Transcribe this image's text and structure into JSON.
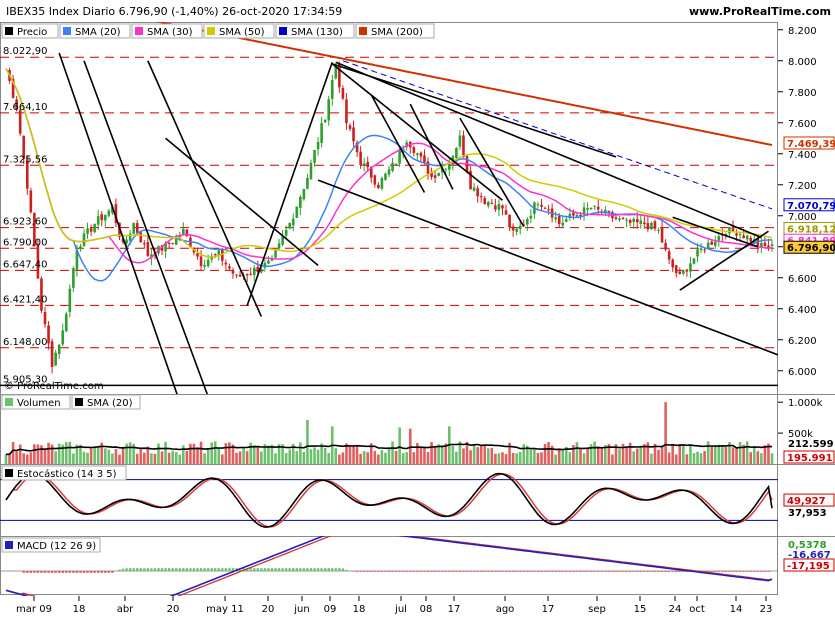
{
  "header": {
    "title": "IBEX35 Index Diario 6.796,90 (-1,40%) 26-oct-2020 17:34:59",
    "site": "www.ProRealTime.com",
    "copyright": "© ProRealTime.com"
  },
  "colors": {
    "price_line": "#000000",
    "sma20": "#3b82f6",
    "sma30": "#ff33cc",
    "sma50": "#cccc00",
    "sma130": "#0000cc",
    "sma200": "#cc3300",
    "up_candle": "#2e9e2e",
    "down_candle": "#cc1f1f",
    "level_line": "#cc0000",
    "vol_up": "#6cc06c",
    "vol_down": "#e06060"
  },
  "chart_data": [
    {
      "type": "candlestick",
      "title": "IBEX35 Index Diario",
      "legend": [
        "Precio",
        "SMA (20)",
        "SMA (30)",
        "SMA (50)",
        "SMA (130)",
        "SMA (200)"
      ],
      "x_ticks": [
        "mar 09",
        "18",
        "abr",
        "20",
        "may 11",
        "20",
        "jun",
        "09",
        "18",
        "jul",
        "08",
        "17",
        "ago",
        "17",
        "sep",
        "15",
        "24",
        "oct",
        "14",
        "23"
      ],
      "y_ticks": [
        "8.200",
        "8.000",
        "7.800",
        "7.600",
        "7.400",
        "7.200",
        "7.000",
        "6.800",
        "6.600",
        "6.400",
        "6.200",
        "6.000"
      ],
      "ylim": [
        5850,
        8250
      ],
      "levels": [
        8022.9,
        7664.1,
        7325.56,
        6923.6,
        6790.0,
        6647.4,
        6421.4,
        6148.0,
        5905.3
      ],
      "level_labels": [
        "8.022,90",
        "7.664,10",
        "7.325,56",
        "6.923,60",
        "6.790,00",
        "6.647,40",
        "6.421,40",
        "6.148,00",
        "5.905,30"
      ],
      "close_points": [
        [
          0,
          7950
        ],
        [
          3,
          7700
        ],
        [
          6,
          7200
        ],
        [
          10,
          6400
        ],
        [
          13,
          6050
        ],
        [
          16,
          6250
        ],
        [
          20,
          6800
        ],
        [
          25,
          6950
        ],
        [
          30,
          7050
        ],
        [
          33,
          6800
        ],
        [
          36,
          6950
        ],
        [
          40,
          6750
        ],
        [
          45,
          6800
        ],
        [
          50,
          6900
        ],
        [
          55,
          6700
        ],
        [
          60,
          6750
        ],
        [
          65,
          6600
        ],
        [
          70,
          6650
        ],
        [
          75,
          6700
        ],
        [
          80,
          6950
        ],
        [
          85,
          7250
        ],
        [
          90,
          7650
        ],
        [
          93,
          7980
        ],
        [
          96,
          7600
        ],
        [
          100,
          7350
        ],
        [
          105,
          7200
        ],
        [
          110,
          7350
        ],
        [
          113,
          7500
        ],
        [
          116,
          7400
        ],
        [
          120,
          7250
        ],
        [
          125,
          7350
        ],
        [
          128,
          7500
        ],
        [
          131,
          7200
        ],
        [
          135,
          7100
        ],
        [
          140,
          7050
        ],
        [
          143,
          6880
        ],
        [
          146,
          6950
        ],
        [
          150,
          7100
        ],
        [
          153,
          7050
        ],
        [
          156,
          6950
        ],
        [
          160,
          7000
        ],
        [
          165,
          7050
        ],
        [
          170,
          7000
        ],
        [
          175,
          6950
        ],
        [
          180,
          6950
        ],
        [
          184,
          6900
        ],
        [
          187,
          6700
        ],
        [
          190,
          6600
        ],
        [
          193,
          6700
        ],
        [
          196,
          6780
        ],
        [
          200,
          6850
        ],
        [
          203,
          6900
        ],
        [
          206,
          6900
        ],
        [
          210,
          6850
        ],
        [
          213,
          6800
        ],
        [
          216,
          6797
        ]
      ],
      "values": {
        "sma200": 7469.39,
        "sma130": 7070.79,
        "sma50": 6918.12,
        "sma30": 6841.99,
        "sma20": 6830,
        "close": 6796.9
      },
      "value_labels": [
        "7.469,39",
        "7.070,79",
        "6.918,12",
        "6.841,99",
        "6.796,90"
      ]
    },
    {
      "type": "bar",
      "title": "Volumen",
      "legend": [
        "Volumen",
        "SMA (20)"
      ],
      "y_ticks": [
        "1.000k",
        "500k"
      ],
      "values": {
        "volume": 195991,
        "sma20": 212599
      },
      "value_labels": [
        "212.599",
        "195.991"
      ]
    },
    {
      "type": "line",
      "title": "Estocástico (14 3 5)",
      "legend": [
        "Estocástico (14 3 5)"
      ],
      "values": {
        "k": 37.953,
        "d": 49.927
      },
      "value_labels": [
        "49,927",
        "37,953"
      ]
    },
    {
      "type": "line",
      "title": "MACD (12 26 9)",
      "legend": [
        "MACD (12 26 9)"
      ],
      "values": {
        "histogram": 0.5378,
        "macd": -16.667,
        "signal": -17.195
      },
      "value_labels": [
        "0,5378",
        "-16,667",
        "-17,195"
      ]
    }
  ]
}
